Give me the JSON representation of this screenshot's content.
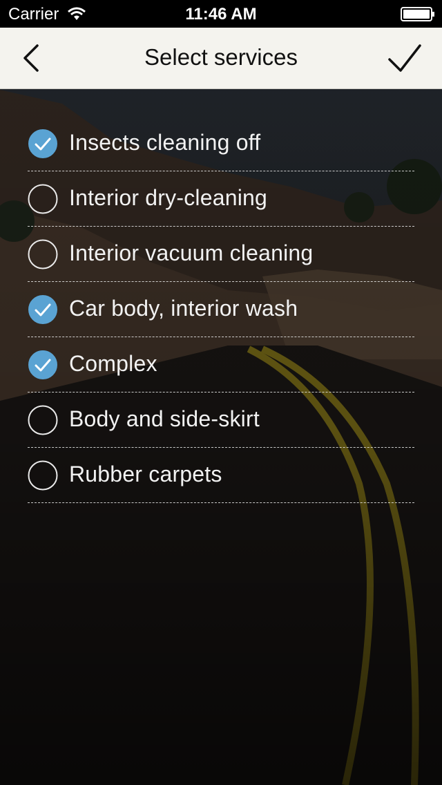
{
  "status_bar": {
    "carrier": "Carrier",
    "time": "11:46 AM"
  },
  "nav": {
    "title": "Select services",
    "back_icon": "chevron-left-icon",
    "confirm_icon": "checkmark-icon"
  },
  "colors": {
    "accent": "#5aa3d3",
    "nav_bg": "#f4f3ee",
    "text": "#f2f2f2"
  },
  "services": [
    {
      "label": "Insects cleaning off",
      "checked": true
    },
    {
      "label": "Interior dry-cleaning",
      "checked": false
    },
    {
      "label": "Interior vacuum cleaning",
      "checked": false
    },
    {
      "label": "Car body, interior wash",
      "checked": true
    },
    {
      "label": "Complex",
      "checked": true
    },
    {
      "label": "Body and side-skirt",
      "checked": false
    },
    {
      "label": "Rubber carpets",
      "checked": false
    }
  ]
}
